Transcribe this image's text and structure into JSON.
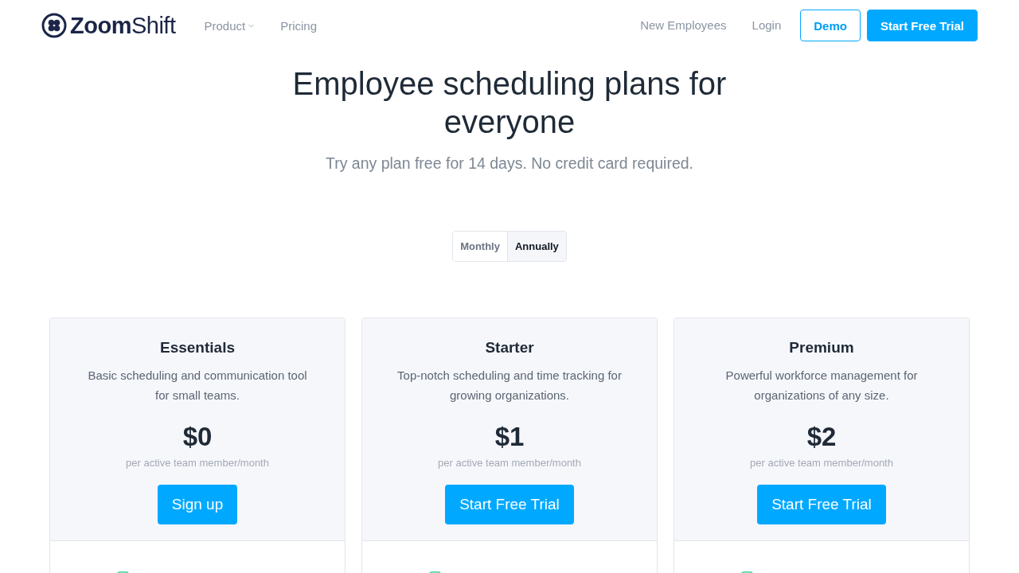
{
  "logo": {
    "text": "**Zoom**Shift"
  },
  "nav": {
    "links": [
      {
        "label": "Product",
        "kind": "dropdown"
      },
      {
        "label": "Pricing",
        "kind": "link"
      }
    ],
    "right_links": [
      {
        "label": "New Employees",
        "kind": "link"
      },
      {
        "label": "Login",
        "kind": "link"
      }
    ],
    "buttons": [
      {
        "label": "Demo",
        "kind": "outline"
      },
      {
        "label": "Start Free Trial",
        "kind": "primary"
      }
    ]
  },
  "hero": {
    "title": "Employee scheduling plans for everyone",
    "subtitle": "Try any plan free for 14 days. No credit card required."
  },
  "billing_toggle": [
    {
      "label": "Monthly",
      "selected": false
    },
    {
      "label": "Annually",
      "selected": true
    }
  ],
  "plans": [
    {
      "name": "Essentials",
      "description": "Basic scheduling and communication tool for small teams.",
      "price": "$0",
      "price_note": "per active team member/month",
      "button": "Sign up"
    },
    {
      "name": "Starter",
      "description": "Top-notch scheduling and time tracking for growing organizations.",
      "price": "$1",
      "price_note": "per active team member/month",
      "button": "Start Free Trial"
    },
    {
      "name": "Premium",
      "description": "Powerful workforce management for organizations of any size.",
      "price": "$2",
      "price_note": "per active team member/month",
      "button": "Start Free Trial"
    }
  ]
}
